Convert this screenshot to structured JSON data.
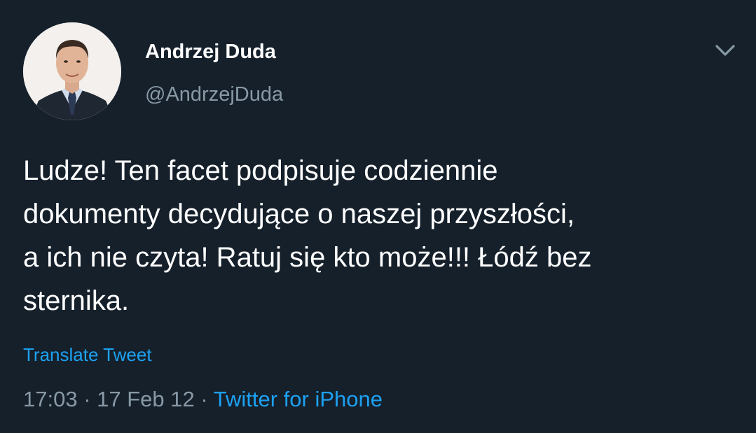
{
  "author": {
    "display_name": "Andrzej Duda",
    "handle": "@AndrzejDuda"
  },
  "tweet": {
    "text": "Ludze! Ten facet podpisuje codziennie\ndokumenty decydujące o naszej przyszłości,\na ich nie czyta! Ratuj się kto może!!! Łódź bez\nsternika.",
    "translate_label": "Translate Tweet"
  },
  "meta": {
    "time": "17:03",
    "separator": " · ",
    "date": "17 Feb 12",
    "source": "Twitter for iPhone"
  },
  "icons": {
    "menu": "chevron-down-icon"
  },
  "colors": {
    "background": "#15202b",
    "primary_text": "#ffffff",
    "secondary_text": "#8899a6",
    "link": "#1da1f2"
  }
}
